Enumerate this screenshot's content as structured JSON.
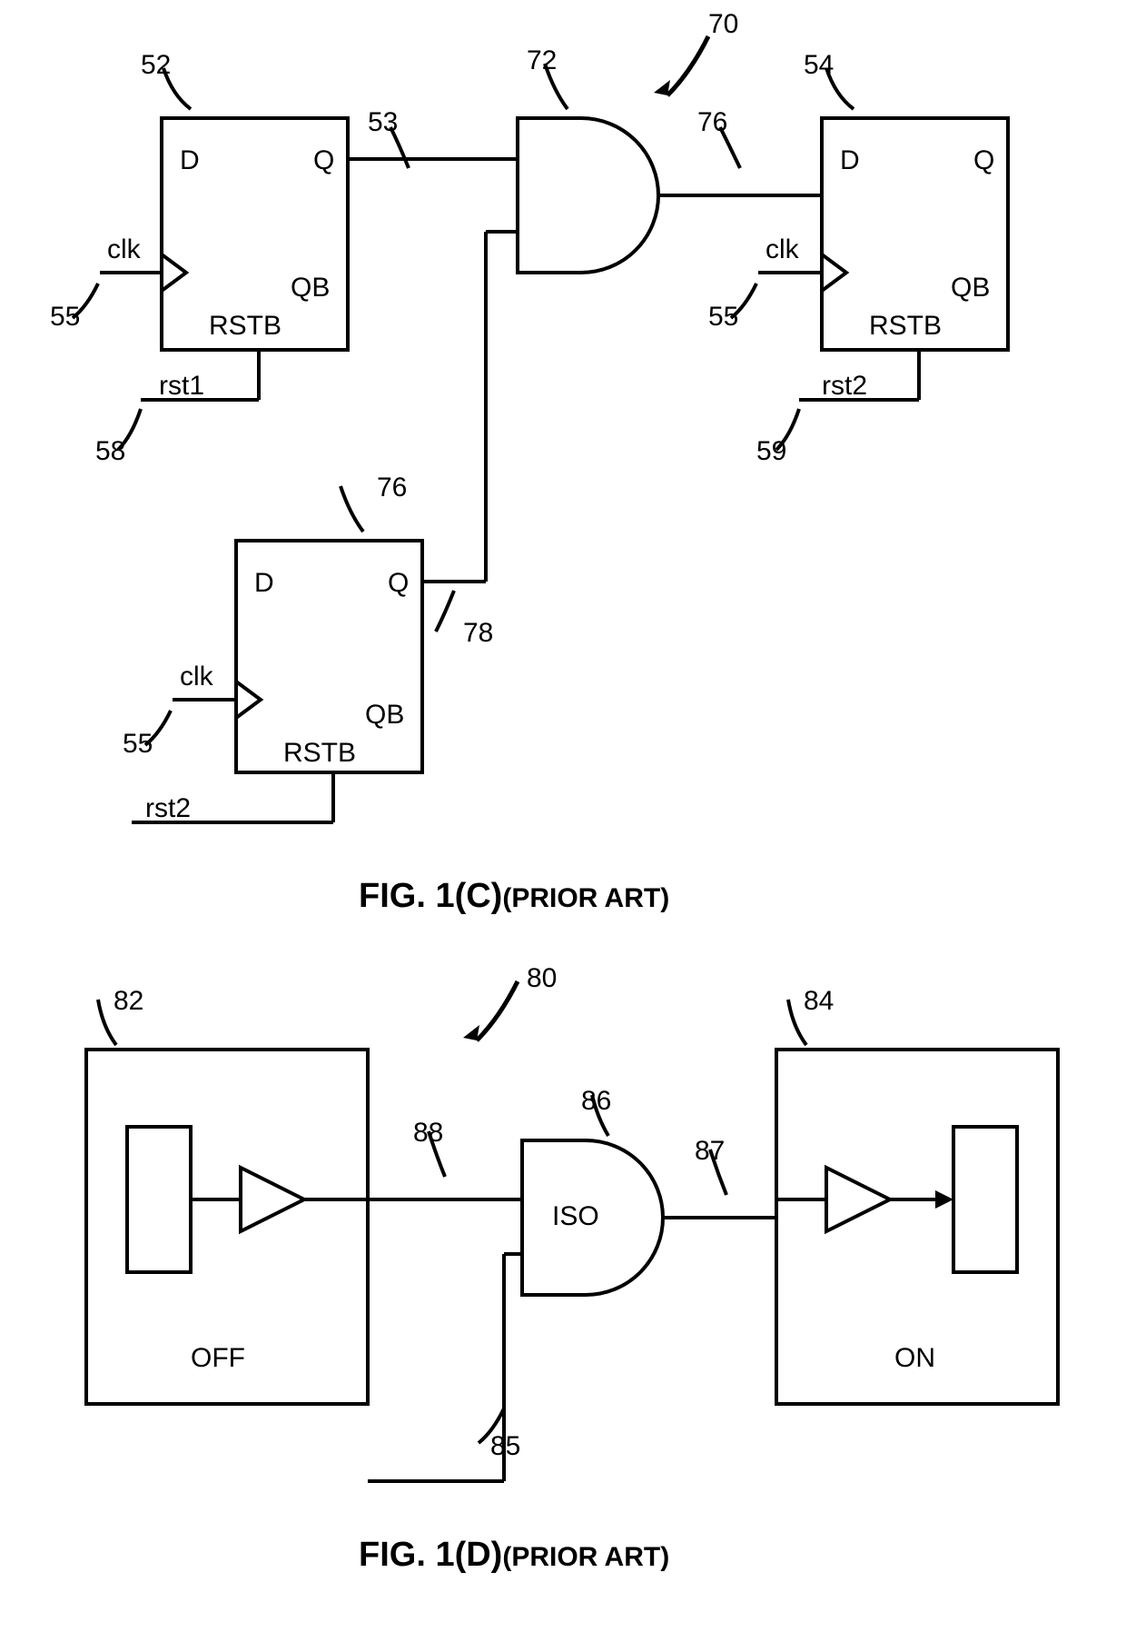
{
  "figC": {
    "ref_main": "70",
    "ff1": {
      "ref": "52",
      "d": "D",
      "q": "Q",
      "qb": "QB",
      "rstb": "RSTB",
      "clk": "clk",
      "clk_ref": "55",
      "rst_label": "rst1",
      "rst_ref": "58",
      "q_ref": "53"
    },
    "ff2": {
      "ref": "54",
      "d": "D",
      "q": "Q",
      "qb": "QB",
      "rstb": "RSTB",
      "clk": "clk",
      "clk_ref": "55",
      "rst_label": "rst2",
      "rst_ref": "59"
    },
    "ff3": {
      "ref": "76",
      "d": "D",
      "q": "Q",
      "qb": "QB",
      "rstb": "RSTB",
      "clk": "clk",
      "clk_ref": "55",
      "rst_label": "rst2",
      "q_ref": "78"
    },
    "and": {
      "ref": "72",
      "out_ref": "76"
    },
    "caption_main": "FIG. 1(C)",
    "caption_sub": "(PRIOR ART)"
  },
  "figD": {
    "ref_main": "80",
    "block_left": {
      "ref": "82",
      "state": "OFF"
    },
    "block_right": {
      "ref": "84",
      "state": "ON"
    },
    "iso": {
      "ref": "86",
      "label": "ISO"
    },
    "wire_in": {
      "ref": "88"
    },
    "wire_out": {
      "ref": "87"
    },
    "ctrl": {
      "ref": "85"
    },
    "caption_main": "FIG. 1(D)",
    "caption_sub": "(PRIOR ART)"
  }
}
